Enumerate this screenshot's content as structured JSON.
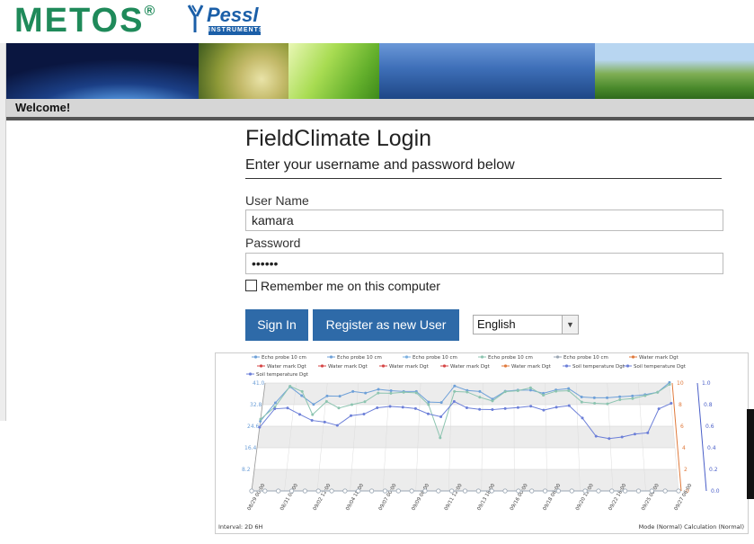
{
  "branding": {
    "metos": "METOS",
    "registered": "®",
    "pessl": "Pessl",
    "pessl_sub": "INSTRUMENTS"
  },
  "header": {
    "welcome": "Welcome!"
  },
  "login": {
    "title": "FieldClimate Login",
    "subtitle": "Enter your username and password below",
    "username_label": "User Name",
    "username_value": "kamara",
    "password_label": "Password",
    "password_value": "••••••",
    "remember_label": "Remember me on this computer",
    "signin_label": "Sign In",
    "register_label": "Register as new User",
    "language_selected": "English"
  },
  "chart_legend": {
    "row1": [
      "Echo probe 10 cm",
      "Echo probe 10 cm",
      "Echo probe 10 cm",
      "Echo probe 10 cm",
      "Echo probe 10 cm",
      "Water mark Dgt"
    ],
    "row2": [
      "Water mark Dgt",
      "Water mark Dgt",
      "Water mark Dgt",
      "Water mark Dgt",
      "Water mark Dgt",
      "Soil temperature Dgt",
      "Soil temperature Dgt"
    ],
    "row3": [
      "Soil temperature Dgt"
    ]
  },
  "chart_data": {
    "type": "line",
    "x": [
      "08/29 00:00",
      "08/31 06:00",
      "09/02 12:00",
      "09/04 18:00",
      "09/07 00:00",
      "09/09 06:00",
      "09/11 12:00",
      "09/13 18:00",
      "09/16 00:00",
      "09/18 06:00",
      "09/20 12:00",
      "09/22 18:00",
      "09/25 00:00",
      "09/27 06:00"
    ],
    "left_axis_ticks": [
      "41.0",
      "32.8",
      "24.6",
      "16.4",
      "8.2",
      ""
    ],
    "right_axis1_ticks": [
      "10",
      "8",
      "6",
      "4",
      "2",
      "0"
    ],
    "right_axis2_ticks": [
      "1.0",
      "0.8",
      "0.6",
      "0.4",
      "0.2",
      "0.0"
    ],
    "series": [
      {
        "color": "#6ea0d8",
        "values": [
          26.5,
          33.5,
          39.6,
          36.2,
          32.9,
          36.1,
          36.0,
          37.8,
          37.2,
          38.6,
          38.1,
          37.8,
          37.8,
          33.8,
          33.6,
          39.9,
          38.2,
          37.8,
          34.9,
          37.9,
          38.3,
          38.3,
          37.1,
          38.4,
          38.9,
          35.7,
          35.4,
          35.4,
          35.8,
          36.1,
          36.6,
          37.5,
          41.2
        ]
      },
      {
        "color": "#8cc4b0",
        "values": [
          27.3,
          31.9,
          39.8,
          37.8,
          29.0,
          34.0,
          31.5,
          32.8,
          33.9,
          37.2,
          37.1,
          37.5,
          37.3,
          32.8,
          20.2,
          37.8,
          37.6,
          35.6,
          34.2,
          37.7,
          38.1,
          39.2,
          36.4,
          37.9,
          38.1,
          33.8,
          33.3,
          33.1,
          34.7,
          35.1,
          36.2,
          37.5,
          40.5
        ]
      },
      {
        "color": "#6c7fd8",
        "values": [
          24.2,
          31.2,
          31.5,
          29.1,
          26.8,
          26.2,
          24.9,
          28.6,
          29.2,
          31.6,
          32.1,
          31.8,
          31.3,
          29.3,
          28.2,
          34.0,
          31.6,
          31.0,
          30.9,
          31.3,
          31.7,
          32.2,
          30.7,
          31.8,
          32.4,
          27.7,
          20.8,
          19.9,
          20.5,
          21.6,
          22.1,
          31.2,
          33.3
        ]
      },
      {
        "color": "#9aa6b3",
        "values": [
          0,
          0,
          0,
          0,
          0,
          0,
          0,
          0,
          0,
          0,
          0,
          0,
          0,
          0,
          0,
          0,
          0,
          0,
          0,
          0,
          0,
          0,
          0,
          0,
          0,
          0,
          0,
          0,
          0,
          0,
          0,
          0,
          0
        ]
      }
    ],
    "annotation_left": "Interval: 2D 6H",
    "annotation_right": "Mode (Normal) Calculation (Normal)"
  }
}
